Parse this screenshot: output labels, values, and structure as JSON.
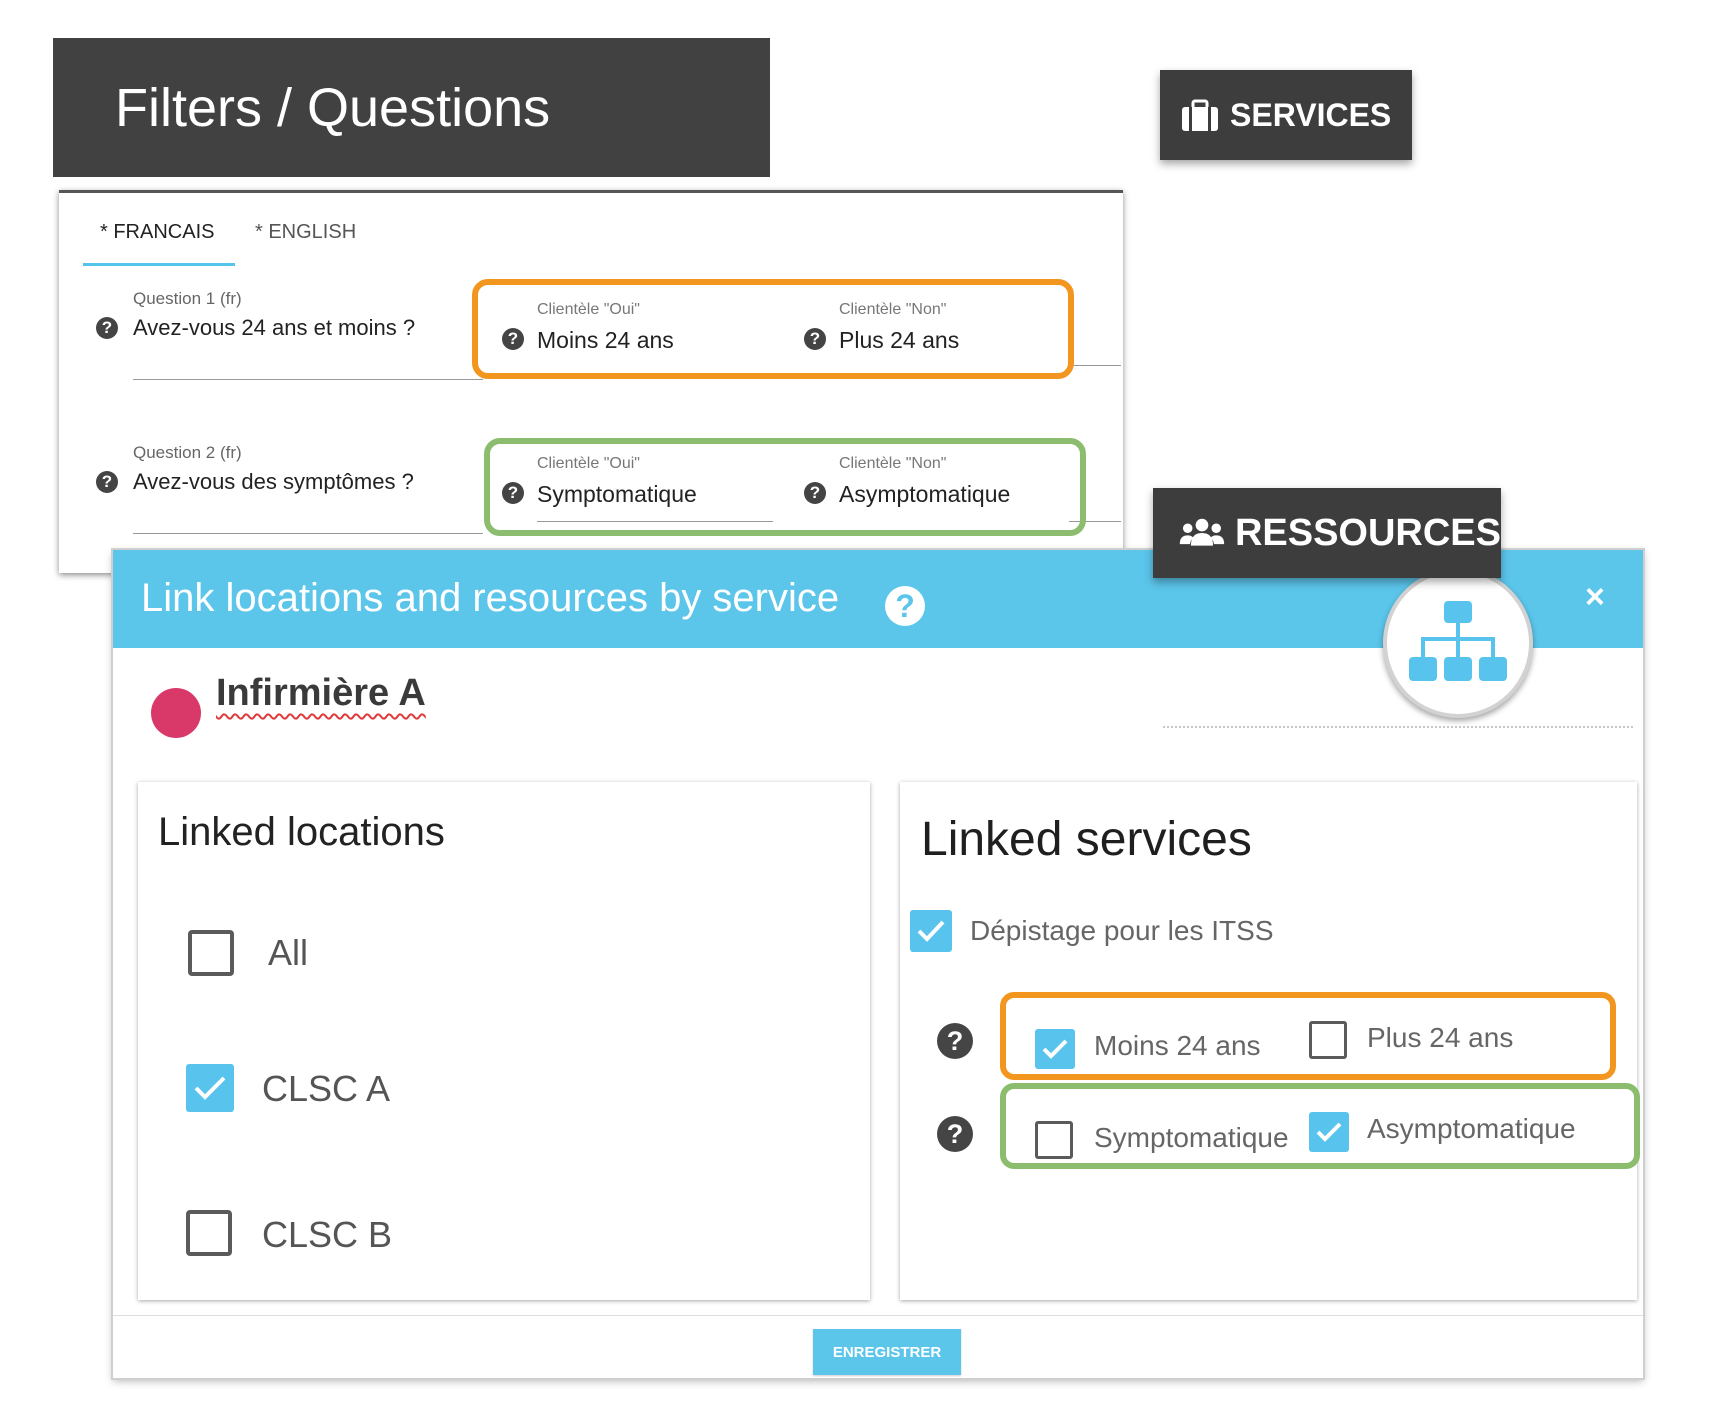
{
  "header": {
    "title": "Filters / Questions"
  },
  "badges": {
    "services": {
      "label": "SERVICES",
      "icon": "briefcase-icon"
    },
    "ressources": {
      "label": "RESSOURCES",
      "icon": "users-icon"
    }
  },
  "form": {
    "tabs": [
      {
        "label": "* FRANCAIS",
        "active": true
      },
      {
        "label": "* ENGLISH",
        "active": false
      }
    ],
    "questions": [
      {
        "label": "Question 1 (fr)",
        "text": "Avez-vous 24 ans et moins ?",
        "yes_label": "Clientèle \"Oui\"",
        "yes_value": "Moins 24 ans",
        "no_label": "Clientèle \"Non\"",
        "no_value": "Plus 24 ans",
        "highlight": "#f2961f"
      },
      {
        "label": "Question 2 (fr)",
        "text": "Avez-vous des symptômes ?",
        "yes_label": "Clientèle \"Oui\"",
        "yes_value": "Symptomatique",
        "no_label": "Clientèle \"Non\"",
        "no_value": "Asymptomatique",
        "highlight": "#8cbd6e"
      }
    ]
  },
  "modal": {
    "title": "Link locations and resources by service",
    "help_icon": "?",
    "close_icon": "×",
    "header_color": "#5bc5ea",
    "resource": {
      "name": "Infirmière A",
      "color": "#d93968"
    },
    "locations": {
      "title": "Linked locations",
      "items": [
        {
          "label": "All",
          "checked": false
        },
        {
          "label": "CLSC A",
          "checked": true
        },
        {
          "label": "CLSC B",
          "checked": false
        }
      ]
    },
    "services": {
      "title": "Linked services",
      "service": {
        "label": "Dépistage pour les ITSS",
        "checked": true
      },
      "filters": [
        {
          "yes": {
            "label": "Moins 24 ans",
            "checked": true
          },
          "no": {
            "label": "Plus 24 ans",
            "checked": false
          }
        },
        {
          "yes": {
            "label": "Symptomatique",
            "checked": false
          },
          "no": {
            "label": "Asymptomatique",
            "checked": true
          }
        }
      ]
    },
    "save_label": "ENREGISTRER"
  }
}
